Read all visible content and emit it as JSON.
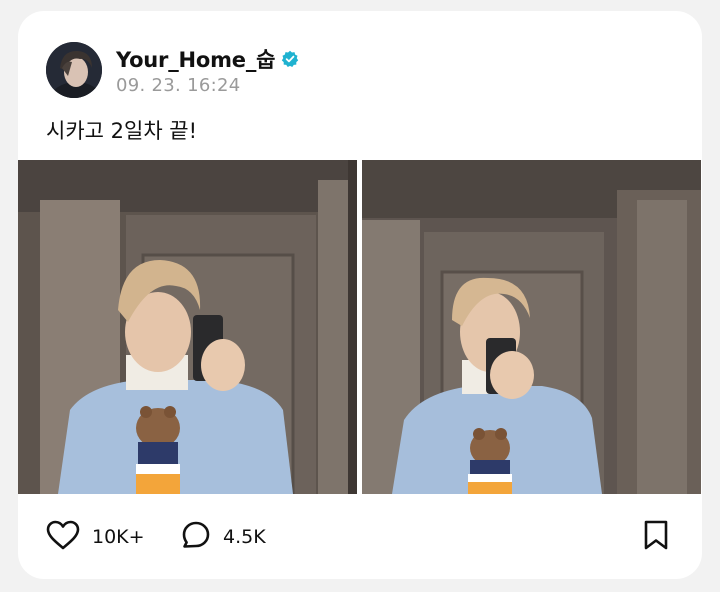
{
  "post": {
    "author": {
      "username": "Your_Home_숩",
      "verified": true,
      "avatar_icon": "profile-avatar"
    },
    "timestamp": "09. 23. 16:24",
    "text": "시카고 2일차 끝!",
    "photos": [
      {
        "description": "mirror-selfie-1"
      },
      {
        "description": "mirror-selfie-2"
      }
    ],
    "stats": {
      "likes": "10K+",
      "comments": "4.5K"
    },
    "icons": {
      "like": "heart-icon",
      "comment": "comment-bubble-icon",
      "bookmark": "bookmark-icon",
      "verified": "verified-badge-icon"
    },
    "colors": {
      "verified_badge": "#1fb2d0",
      "text_primary": "#111111",
      "text_secondary": "#9a9a9a",
      "card_background": "#ffffff"
    }
  }
}
